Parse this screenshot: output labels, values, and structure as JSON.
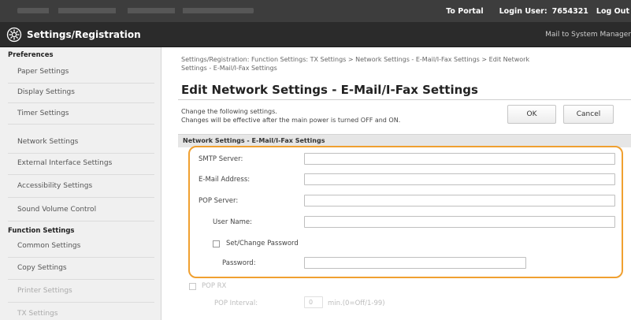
{
  "topbar": {
    "portal_link": "To Portal",
    "login_user_label": "Login User:",
    "login_user_id": "7654321",
    "logout_label": "Log Out"
  },
  "titlebar": {
    "title": "Settings/Registration",
    "mail_link": "Mail to System Manager"
  },
  "sidebar": {
    "preferences_heading": "Preferences",
    "preferences_items": [
      "Paper Settings",
      "Display Settings",
      "Timer Settings",
      "Network Settings",
      "External Interface Settings",
      "Accessibility Settings",
      "Sound Volume Control"
    ],
    "function_heading": "Function Settings",
    "function_items": [
      "Common Settings",
      "Copy Settings",
      "Printer Settings",
      "TX Settings"
    ]
  },
  "main": {
    "breadcrumb_line1": "Settings/Registration: Function Settings: TX Settings > Network Settings - E-Mail/I-Fax Settings > Edit Network",
    "breadcrumb_line2": "Settings - E-Mail/I-Fax Settings",
    "page_title": "Edit Network Settings - E-Mail/I-Fax Settings",
    "desc_line1": "Change the following settings.",
    "desc_line2": "Changes will be effective after the main power is turned OFF and ON.",
    "ok_label": "OK",
    "cancel_label": "Cancel",
    "section_heading": "Network Settings - E-Mail/I-Fax Settings",
    "smtp_server_label": "SMTP Server:",
    "email_address_label": "E-Mail Address:",
    "pop_server_label": "POP Server:",
    "user_name_label": "User Name:",
    "set_change_password_label": "Set/Change Password",
    "password_label": "Password:",
    "pop_rx_label": "POP RX",
    "pop_interval_label": "POP Interval:",
    "pop_interval_value": "0",
    "pop_interval_unit": "min.(0=Off/1-99)"
  },
  "colors": {
    "highlight": "#f0a030"
  }
}
